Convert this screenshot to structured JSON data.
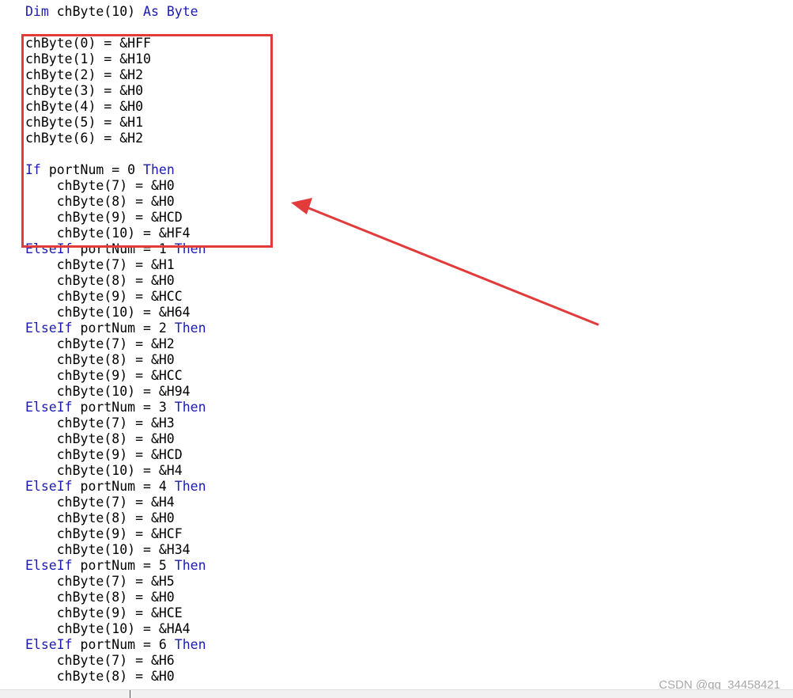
{
  "code_lines": [
    [
      {
        "t": "Dim ",
        "kw": true
      },
      {
        "t": "chByte(10) ",
        "kw": false
      },
      {
        "t": "As Byte",
        "kw": true
      }
    ],
    [],
    [
      {
        "t": "chByte(0) = &HFF",
        "kw": false
      }
    ],
    [
      {
        "t": "chByte(1) = &H10",
        "kw": false
      }
    ],
    [
      {
        "t": "chByte(2) = &H2",
        "kw": false
      }
    ],
    [
      {
        "t": "chByte(3) = &H0",
        "kw": false
      }
    ],
    [
      {
        "t": "chByte(4) = &H0",
        "kw": false
      }
    ],
    [
      {
        "t": "chByte(5) = &H1",
        "kw": false
      }
    ],
    [
      {
        "t": "chByte(6) = &H2",
        "kw": false
      }
    ],
    [],
    [
      {
        "t": "If ",
        "kw": true
      },
      {
        "t": "portNum = 0 ",
        "kw": false
      },
      {
        "t": "Then",
        "kw": true
      }
    ],
    [
      {
        "t": "    chByte(7) = &H0",
        "kw": false
      }
    ],
    [
      {
        "t": "    chByte(8) = &H0",
        "kw": false
      }
    ],
    [
      {
        "t": "    chByte(9) = &HCD",
        "kw": false
      }
    ],
    [
      {
        "t": "    chByte(10) = &HF4",
        "kw": false
      }
    ],
    [
      {
        "t": "ElseIf ",
        "kw": true
      },
      {
        "t": "portNum = 1 ",
        "kw": false
      },
      {
        "t": "Then",
        "kw": true
      }
    ],
    [
      {
        "t": "    chByte(7) = &H1",
        "kw": false
      }
    ],
    [
      {
        "t": "    chByte(8) = &H0",
        "kw": false
      }
    ],
    [
      {
        "t": "    chByte(9) = &HCC",
        "kw": false
      }
    ],
    [
      {
        "t": "    chByte(10) = &H64",
        "kw": false
      }
    ],
    [
      {
        "t": "ElseIf ",
        "kw": true
      },
      {
        "t": "portNum = 2 ",
        "kw": false
      },
      {
        "t": "Then",
        "kw": true
      }
    ],
    [
      {
        "t": "    chByte(7) = &H2",
        "kw": false
      }
    ],
    [
      {
        "t": "    chByte(8) = &H0",
        "kw": false
      }
    ],
    [
      {
        "t": "    chByte(9) = &HCC",
        "kw": false
      }
    ],
    [
      {
        "t": "    chByte(10) = &H94",
        "kw": false
      }
    ],
    [
      {
        "t": "ElseIf ",
        "kw": true
      },
      {
        "t": "portNum = 3 ",
        "kw": false
      },
      {
        "t": "Then",
        "kw": true
      }
    ],
    [
      {
        "t": "    chByte(7) = &H3",
        "kw": false
      }
    ],
    [
      {
        "t": "    chByte(8) = &H0",
        "kw": false
      }
    ],
    [
      {
        "t": "    chByte(9) = &HCD",
        "kw": false
      }
    ],
    [
      {
        "t": "    chByte(10) = &H4",
        "kw": false
      }
    ],
    [
      {
        "t": "ElseIf ",
        "kw": true
      },
      {
        "t": "portNum = 4 ",
        "kw": false
      },
      {
        "t": "Then",
        "kw": true
      }
    ],
    [
      {
        "t": "    chByte(7) = &H4",
        "kw": false
      }
    ],
    [
      {
        "t": "    chByte(8) = &H0",
        "kw": false
      }
    ],
    [
      {
        "t": "    chByte(9) = &HCF",
        "kw": false
      }
    ],
    [
      {
        "t": "    chByte(10) = &H34",
        "kw": false
      }
    ],
    [
      {
        "t": "ElseIf ",
        "kw": true
      },
      {
        "t": "portNum = 5 ",
        "kw": false
      },
      {
        "t": "Then",
        "kw": true
      }
    ],
    [
      {
        "t": "    chByte(7) = &H5",
        "kw": false
      }
    ],
    [
      {
        "t": "    chByte(8) = &H0",
        "kw": false
      }
    ],
    [
      {
        "t": "    chByte(9) = &HCE",
        "kw": false
      }
    ],
    [
      {
        "t": "    chByte(10) = &HA4",
        "kw": false
      }
    ],
    [
      {
        "t": "ElseIf ",
        "kw": true
      },
      {
        "t": "portNum = 6 ",
        "kw": false
      },
      {
        "t": "Then",
        "kw": true
      }
    ],
    [
      {
        "t": "    chByte(7) = &H6",
        "kw": false
      }
    ],
    [
      {
        "t": "    chByte(8) = &H0",
        "kw": false
      }
    ]
  ],
  "watermark": "CSDN @qq_34458421",
  "colors": {
    "keyword": "#1b1bb0",
    "text": "#000000",
    "annotation": "#e23b3b",
    "watermark": "#a8a8a8"
  }
}
